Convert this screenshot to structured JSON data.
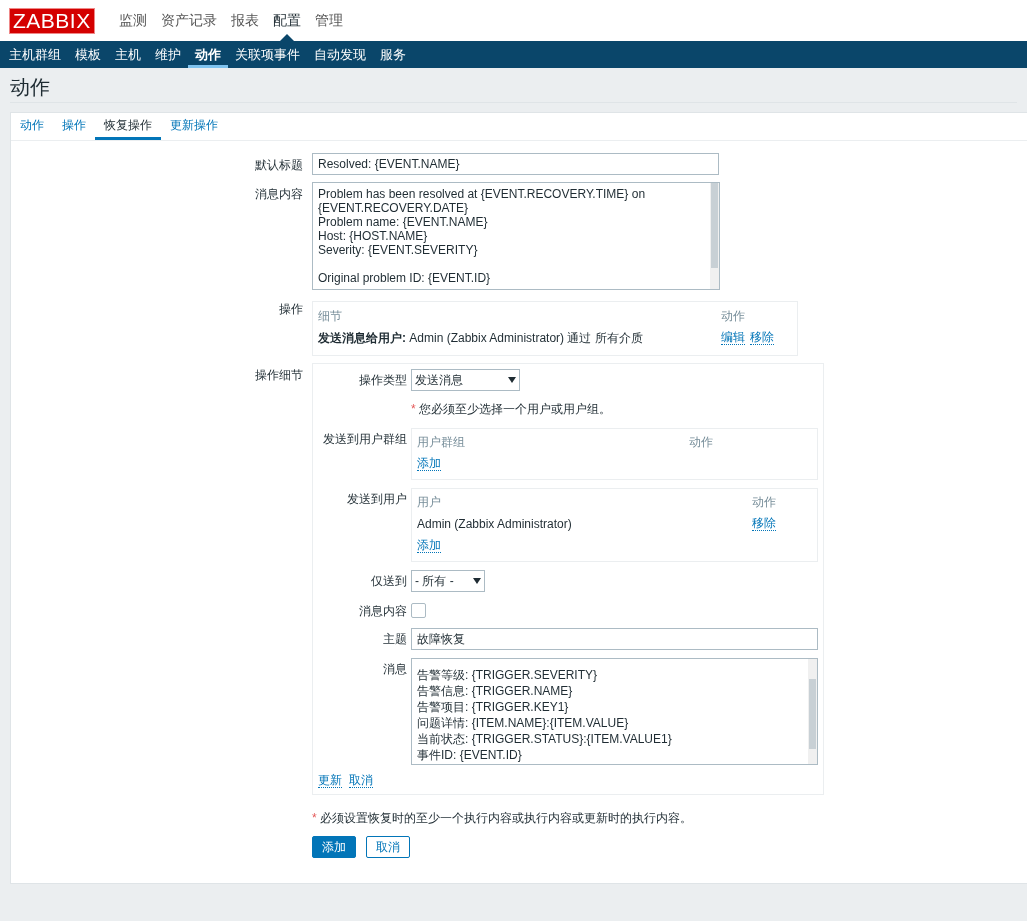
{
  "logo": "ZABBIX",
  "main_menu": [
    {
      "label": "监测",
      "selected": false
    },
    {
      "label": "资产记录",
      "selected": false
    },
    {
      "label": "报表",
      "selected": false
    },
    {
      "label": "配置",
      "selected": true
    },
    {
      "label": "管理",
      "selected": false
    }
  ],
  "sub_menu": [
    {
      "label": "主机群组",
      "selected": false
    },
    {
      "label": "模板",
      "selected": false
    },
    {
      "label": "主机",
      "selected": false
    },
    {
      "label": "维护",
      "selected": false
    },
    {
      "label": "动作",
      "selected": true
    },
    {
      "label": "关联项事件",
      "selected": false
    },
    {
      "label": "自动发现",
      "selected": false
    },
    {
      "label": "服务",
      "selected": false
    }
  ],
  "page_title": "动作",
  "tabs": [
    {
      "label": "动作",
      "selected": false
    },
    {
      "label": "操作",
      "selected": false
    },
    {
      "label": "恢复操作",
      "selected": true
    },
    {
      "label": "更新操作",
      "selected": false
    }
  ],
  "form": {
    "default_subject": {
      "label": "默认标题",
      "value": "Resolved: {EVENT.NAME}"
    },
    "default_message": {
      "label": "消息内容",
      "paragraphs": [
        [
          "Problem has been resolved at {EVENT.RECOVERY.TIME} on",
          "{EVENT.RECOVERY.DATE}",
          "Problem name: {EVENT.NAME}",
          "Host: {HOST.NAME}",
          "Severity: {EVENT.SEVERITY}"
        ],
        [
          "Original problem ID: {EVENT.ID}"
        ]
      ]
    },
    "operations": {
      "label": "操作",
      "columns": [
        "细节",
        "动作"
      ],
      "rows": [
        {
          "detail": "**发送消息给用户:** Admin (Zabbix Administrator) 通过 所有介质",
          "actions": [
            "编辑",
            "移除"
          ]
        }
      ]
    },
    "operation_details": {
      "label": "操作细节",
      "operation_type": {
        "label": "操作类型",
        "value": "发送消息"
      },
      "required_note": {
        "mark": "*",
        "text": "您必须至少选择一个用户或用户组。"
      },
      "user_groups": {
        "label": "发送到用户群组",
        "columns": [
          "用户群组",
          "动作"
        ],
        "add_link": "添加"
      },
      "users": {
        "label": "发送到用户",
        "columns": [
          "用户",
          "动作"
        ],
        "rows": [
          {
            "name": "Admin (Zabbix Administrator)",
            "action": "移除"
          }
        ],
        "add_link": "添加"
      },
      "send_only_to": {
        "label": "仅送到",
        "value": "- 所有 -"
      },
      "default_message": {
        "label": "消息内容",
        "checked": false
      },
      "subject": {
        "label": "主题",
        "value": "故障恢复"
      },
      "message": {
        "label": "消息",
        "lines": [
          "告警等级: {TRIGGER.SEVERITY}",
          "告警信息: {TRIGGER.NAME}",
          "告警项目: {TRIGGER.KEY1}",
          "问题详情: {ITEM.NAME}:{ITEM.VALUE}",
          "当前状态: {TRIGGER.STATUS}:{ITEM.VALUE1}",
          "事件ID: {EVENT.ID}"
        ]
      },
      "links": [
        "更新",
        "取消"
      ]
    },
    "footer_note": {
      "mark": "*",
      "text": "必须设置恢复时的至少一个执行内容或执行内容或更新时的执行内容。"
    },
    "buttons": [
      {
        "label": "添加",
        "kind": "primary"
      },
      {
        "label": "取消",
        "kind": "secondary"
      }
    ]
  }
}
